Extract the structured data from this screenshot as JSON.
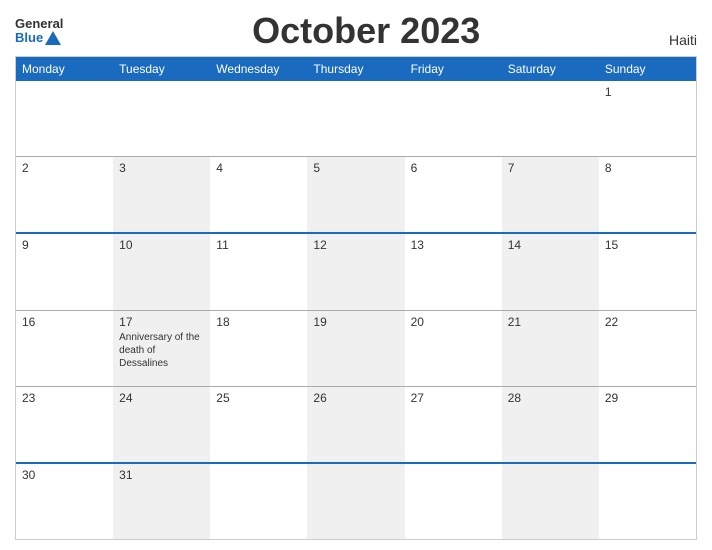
{
  "header": {
    "logo_general": "General",
    "logo_blue": "Blue",
    "title": "October 2023",
    "country": "Haiti"
  },
  "days": [
    "Monday",
    "Tuesday",
    "Wednesday",
    "Thursday",
    "Friday",
    "Saturday",
    "Sunday"
  ],
  "weeks": [
    {
      "blue_top": false,
      "cells": [
        {
          "day": "",
          "event": ""
        },
        {
          "day": "",
          "event": ""
        },
        {
          "day": "",
          "event": ""
        },
        {
          "day": "",
          "event": ""
        },
        {
          "day": "",
          "event": ""
        },
        {
          "day": "",
          "event": ""
        },
        {
          "day": "1",
          "event": ""
        }
      ]
    },
    {
      "blue_top": false,
      "cells": [
        {
          "day": "2",
          "event": ""
        },
        {
          "day": "3",
          "event": ""
        },
        {
          "day": "4",
          "event": ""
        },
        {
          "day": "5",
          "event": ""
        },
        {
          "day": "6",
          "event": ""
        },
        {
          "day": "7",
          "event": ""
        },
        {
          "day": "8",
          "event": ""
        }
      ]
    },
    {
      "blue_top": true,
      "cells": [
        {
          "day": "9",
          "event": ""
        },
        {
          "day": "10",
          "event": ""
        },
        {
          "day": "11",
          "event": ""
        },
        {
          "day": "12",
          "event": ""
        },
        {
          "day": "13",
          "event": ""
        },
        {
          "day": "14",
          "event": ""
        },
        {
          "day": "15",
          "event": ""
        }
      ]
    },
    {
      "blue_top": false,
      "cells": [
        {
          "day": "16",
          "event": ""
        },
        {
          "day": "17",
          "event": "Anniversary of the death of Dessalines"
        },
        {
          "day": "18",
          "event": ""
        },
        {
          "day": "19",
          "event": ""
        },
        {
          "day": "20",
          "event": ""
        },
        {
          "day": "21",
          "event": ""
        },
        {
          "day": "22",
          "event": ""
        }
      ]
    },
    {
      "blue_top": false,
      "cells": [
        {
          "day": "23",
          "event": ""
        },
        {
          "day": "24",
          "event": ""
        },
        {
          "day": "25",
          "event": ""
        },
        {
          "day": "26",
          "event": ""
        },
        {
          "day": "27",
          "event": ""
        },
        {
          "day": "28",
          "event": ""
        },
        {
          "day": "29",
          "event": ""
        }
      ]
    },
    {
      "blue_top": true,
      "cells": [
        {
          "day": "30",
          "event": ""
        },
        {
          "day": "31",
          "event": ""
        },
        {
          "day": "",
          "event": ""
        },
        {
          "day": "",
          "event": ""
        },
        {
          "day": "",
          "event": ""
        },
        {
          "day": "",
          "event": ""
        },
        {
          "day": "",
          "event": ""
        }
      ]
    }
  ]
}
